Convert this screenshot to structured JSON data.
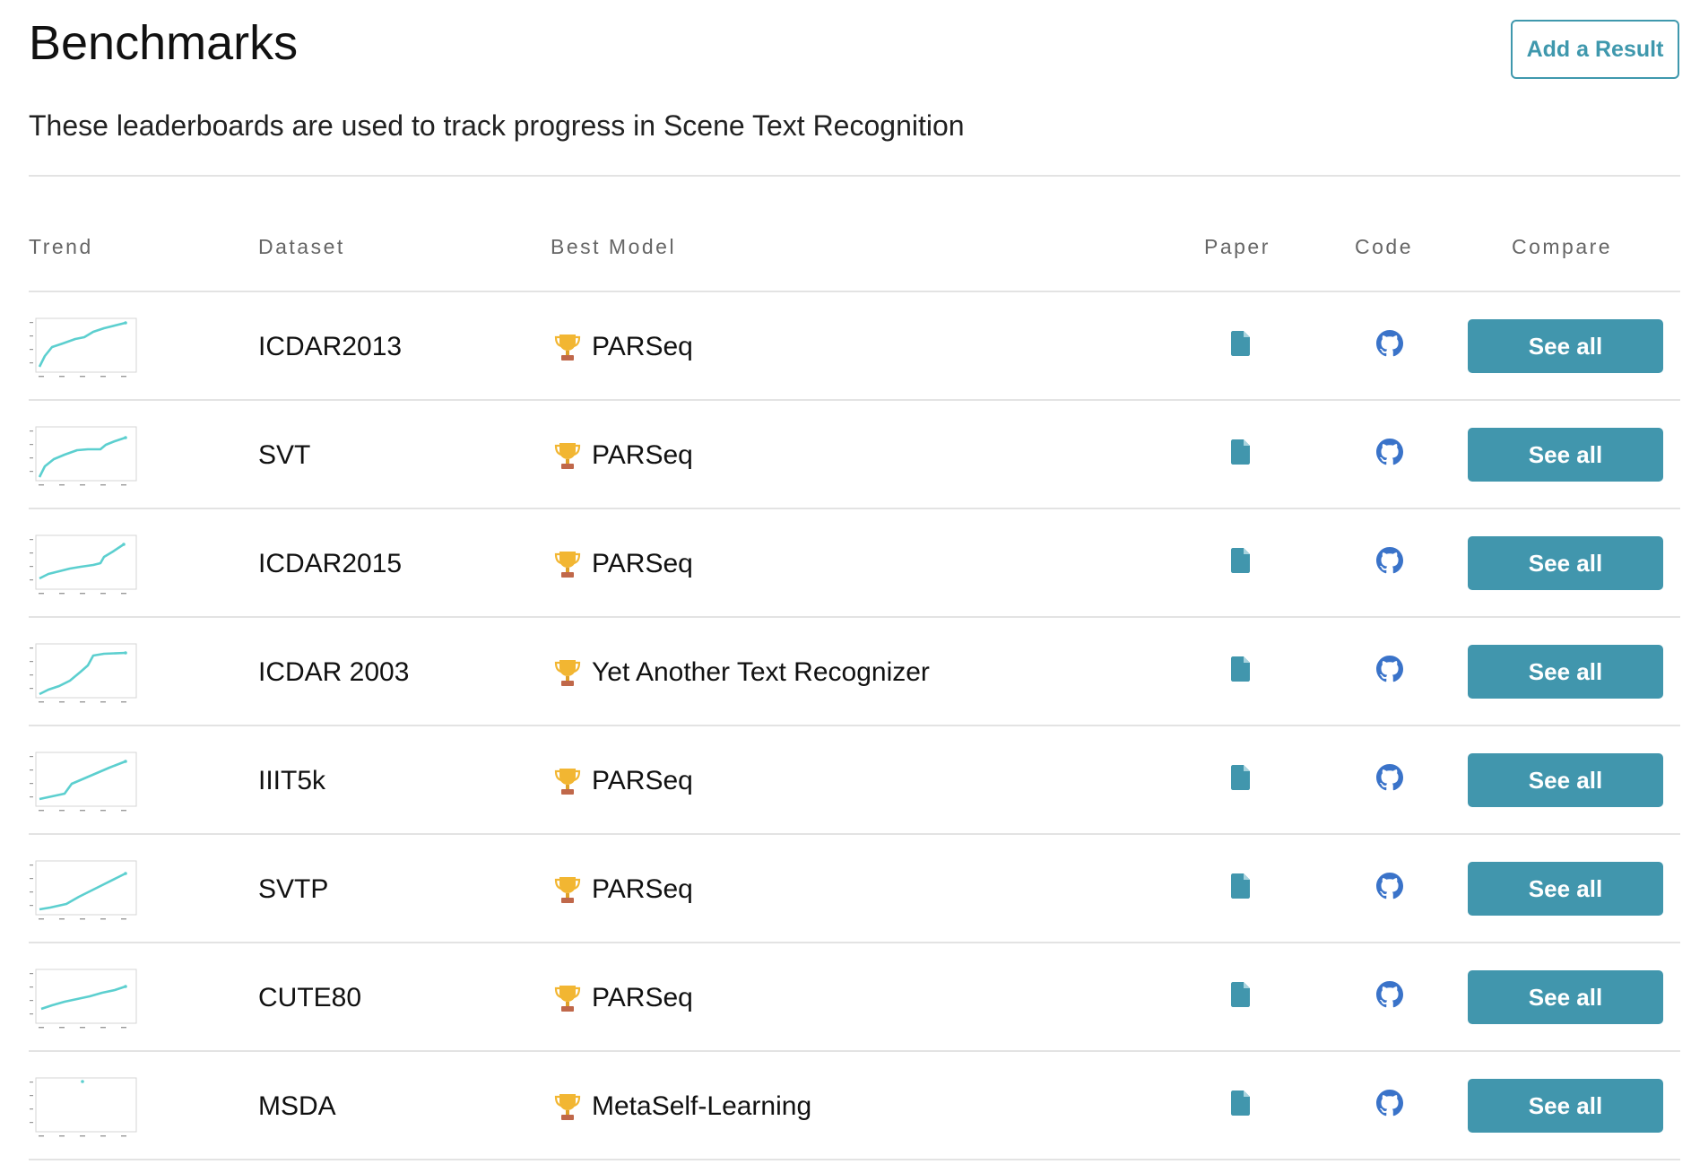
{
  "header": {
    "title": "Benchmarks",
    "add_button_label": "Add a Result",
    "subtitle": "These leaderboards are used to track progress in Scene Text Recognition"
  },
  "columns": {
    "trend": "Trend",
    "dataset": "Dataset",
    "best_model": "Best Model",
    "paper": "Paper",
    "code": "Code",
    "compare": "Compare"
  },
  "colors": {
    "accent": "#4196ad",
    "trend_line": "#5ccfcf",
    "divider": "#e3e3e3",
    "github_icon": "#3a73c9"
  },
  "icons": {
    "trophy": "trophy-icon",
    "paper": "file-icon",
    "code": "github-icon"
  },
  "rows": [
    {
      "dataset": "ICDAR2013",
      "best_model": "PARSeq",
      "compare_label": "See all"
    },
    {
      "dataset": "SVT",
      "best_model": "PARSeq",
      "compare_label": "See all"
    },
    {
      "dataset": "ICDAR2015",
      "best_model": "PARSeq",
      "compare_label": "See all"
    },
    {
      "dataset": "ICDAR 2003",
      "best_model": "Yet Another Text Recognizer",
      "compare_label": "See all"
    },
    {
      "dataset": "IIIT5k",
      "best_model": "PARSeq",
      "compare_label": "See all"
    },
    {
      "dataset": "SVTP",
      "best_model": "PARSeq",
      "compare_label": "See all"
    },
    {
      "dataset": "CUTE80",
      "best_model": "PARSeq",
      "compare_label": "See all"
    },
    {
      "dataset": "MSDA",
      "best_model": "MetaSelf-Learning",
      "compare_label": "See all"
    }
  ]
}
